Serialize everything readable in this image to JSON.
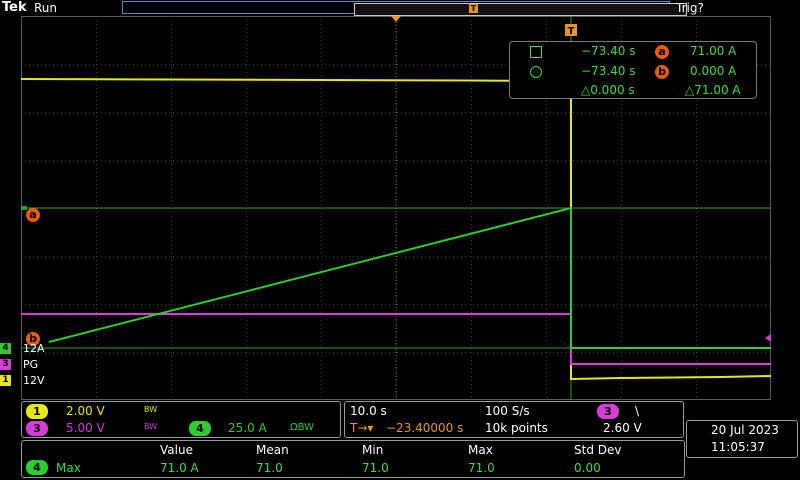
{
  "header": {
    "brand": "Tek",
    "acq_state": "Run",
    "trigger_state": "Trig?",
    "trigger_marker": "T"
  },
  "cursors": {
    "square_time": "−73.40 s",
    "circle_time": "−73.40 s",
    "a_label": "a",
    "a_value": "71.00 A",
    "b_label": "b",
    "b_value": "0.000 A",
    "delta_time": "△0.000 s",
    "delta_value": "△71.00 A"
  },
  "channel_labels": {
    "ch4_num": "4",
    "ch4_text": "12A",
    "ch3_num": "3",
    "ch3_text": "PG",
    "ch1_num": "1",
    "ch1_text": "12V"
  },
  "vertical": {
    "ch1": {
      "num": "1",
      "scale": "2.00 V",
      "bw": "BW"
    },
    "ch3": {
      "num": "3",
      "scale": "5.00 V",
      "bw": "BW"
    },
    "ch4": {
      "num": "4",
      "scale": "25.0 A",
      "bw": "ΩBW"
    }
  },
  "horizontal": {
    "time_div": "10.0 s",
    "sample_rate": "100 S/s",
    "delay": "−23.40000 s",
    "record_length": "10k points",
    "trigger_source": "3",
    "trigger_slope": "\\",
    "trigger_level": "2.60 V"
  },
  "datetime": {
    "date": "20 Jul  2023",
    "time": "11:05:37"
  },
  "measurement": {
    "headers": [
      "Value",
      "Mean",
      "Min",
      "Max",
      "Std Dev"
    ],
    "channel": "4",
    "name": "Max",
    "values": [
      "71.0 A",
      "71.0",
      "71.0",
      "71.0",
      "0.00"
    ]
  },
  "colors": {
    "ch1": "#e6e619",
    "ch3": "#d63cd6",
    "ch4": "#2ecc2e",
    "cursor": "#e85a12",
    "grid": "#555555"
  }
}
